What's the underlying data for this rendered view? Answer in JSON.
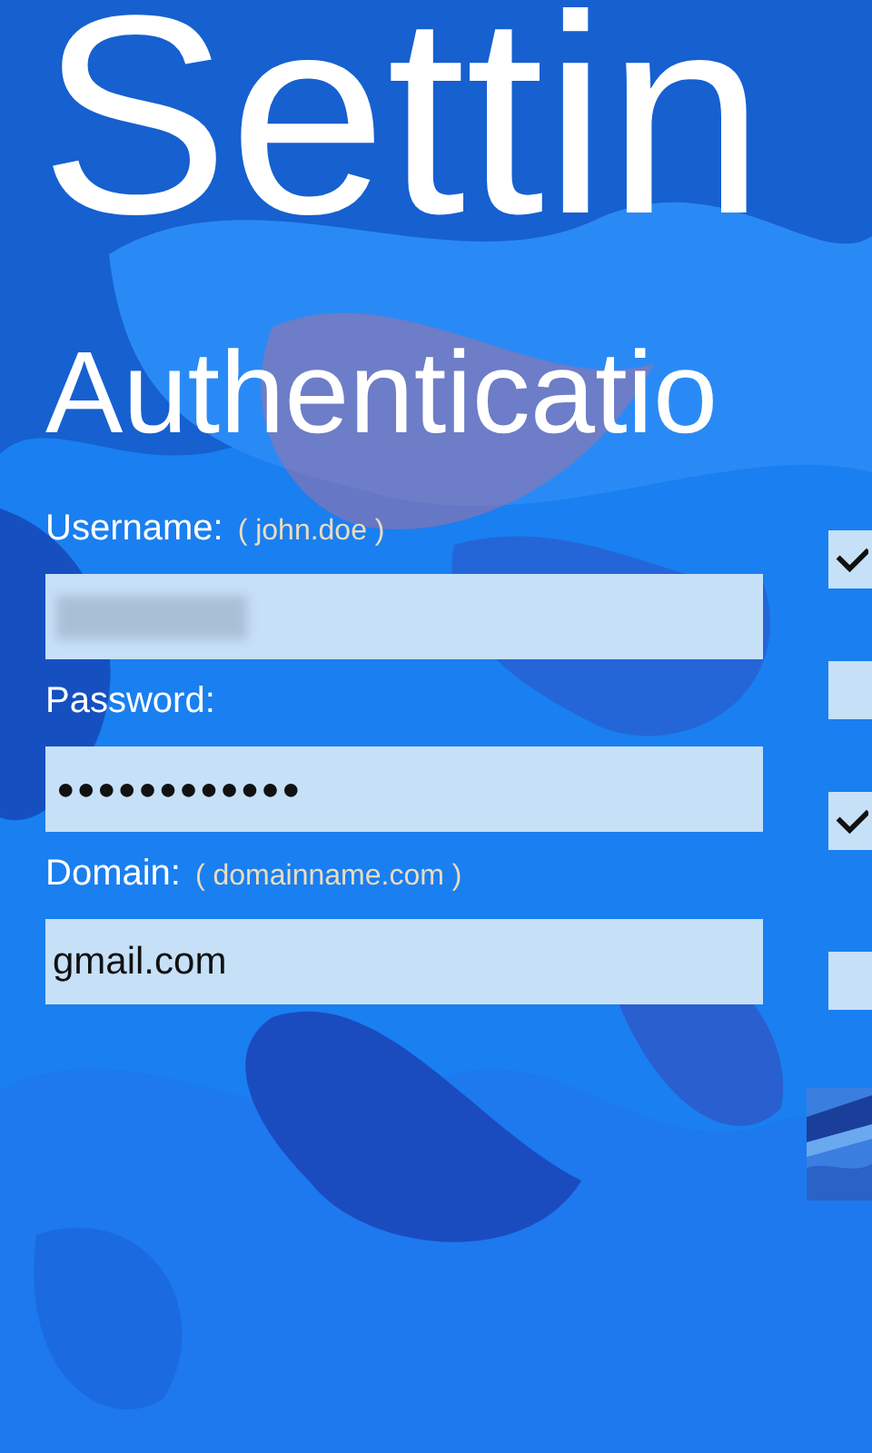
{
  "title": "Settin",
  "section": "Authenticatio",
  "fields": [
    {
      "label": "Username:",
      "hint": "( john.doe )",
      "kind": "redacted"
    },
    {
      "label": "Password:",
      "kind": "password",
      "value": "●●●●●●●●●●●●"
    },
    {
      "label": "Domain:",
      "hint": "( domainname.com )",
      "kind": "text",
      "value": "gmail.com"
    }
  ],
  "options": [
    {
      "checked": true
    },
    {
      "checked": false
    },
    {
      "checked": true
    },
    {
      "checked": false
    }
  ]
}
